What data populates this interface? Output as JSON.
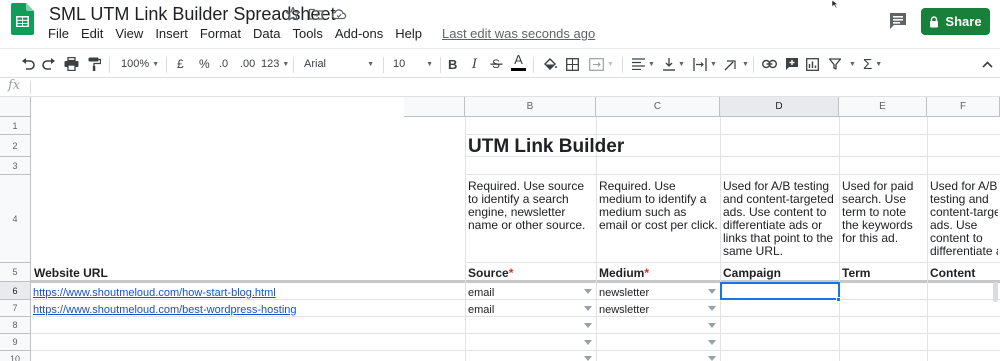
{
  "app": {
    "title": "SML UTM Link Builder Spreadsheet",
    "share_label": "Share",
    "last_edit": "Last edit was seconds ago",
    "brand_color": "#188038",
    "icons": [
      "sheets-logo-icon",
      "star-icon",
      "move-to-folder-icon",
      "cloud-status-icon",
      "comment-icon",
      "lock-icon"
    ]
  },
  "menu": [
    "File",
    "Edit",
    "View",
    "Insert",
    "Format",
    "Data",
    "Tools",
    "Add-ons",
    "Help"
  ],
  "toolbar": {
    "zoom": "100%",
    "currency": "£",
    "percent": "%",
    "decrease_decimal": ".0",
    "increase_decimal": ".00",
    "more_formats": "123",
    "font": "Arial",
    "font_size": "10",
    "bold": "B",
    "italic": "I",
    "text_color": "A"
  },
  "formula_bar": {
    "fx": "fx",
    "value": ""
  },
  "columns": [
    "B",
    "C",
    "D",
    "E",
    "F"
  ],
  "rows": [
    "1",
    "2",
    "3",
    "4",
    "5",
    "6",
    "7",
    "8",
    "9",
    "10"
  ],
  "sheet": {
    "heading": "UTM Link Builder",
    "descriptions": {
      "source": "Required. Use source to identify a search engine, newsletter name or other source.",
      "medium": "Required. Use medium to identify a medium such as email or cost per click.",
      "campaign": "Used for A/B testing and content-targeted ads. Use content to differentiate ads or links that point to the same URL.",
      "term": "Used for paid search. Use term to note the keywords for this ad.",
      "content": "Used for A/B testing and content-targeted ads. Use content to differentiate ads or links that point to the same URL."
    },
    "headers": {
      "website_url": "Website URL",
      "source": "Source",
      "medium": "Medium",
      "campaign": "Campaign",
      "term": "Term",
      "content": "Content",
      "required_mark": "*"
    },
    "data_rows": [
      {
        "url": "https://www.shoutmeloud.com/how-start-blog.html",
        "source": "email",
        "medium": "newsletter"
      },
      {
        "url": "https://www.shoutmeloud.com/best-wordpress-hosting",
        "source": "email",
        "medium": "newsletter"
      }
    ],
    "active_cell": "D6"
  }
}
